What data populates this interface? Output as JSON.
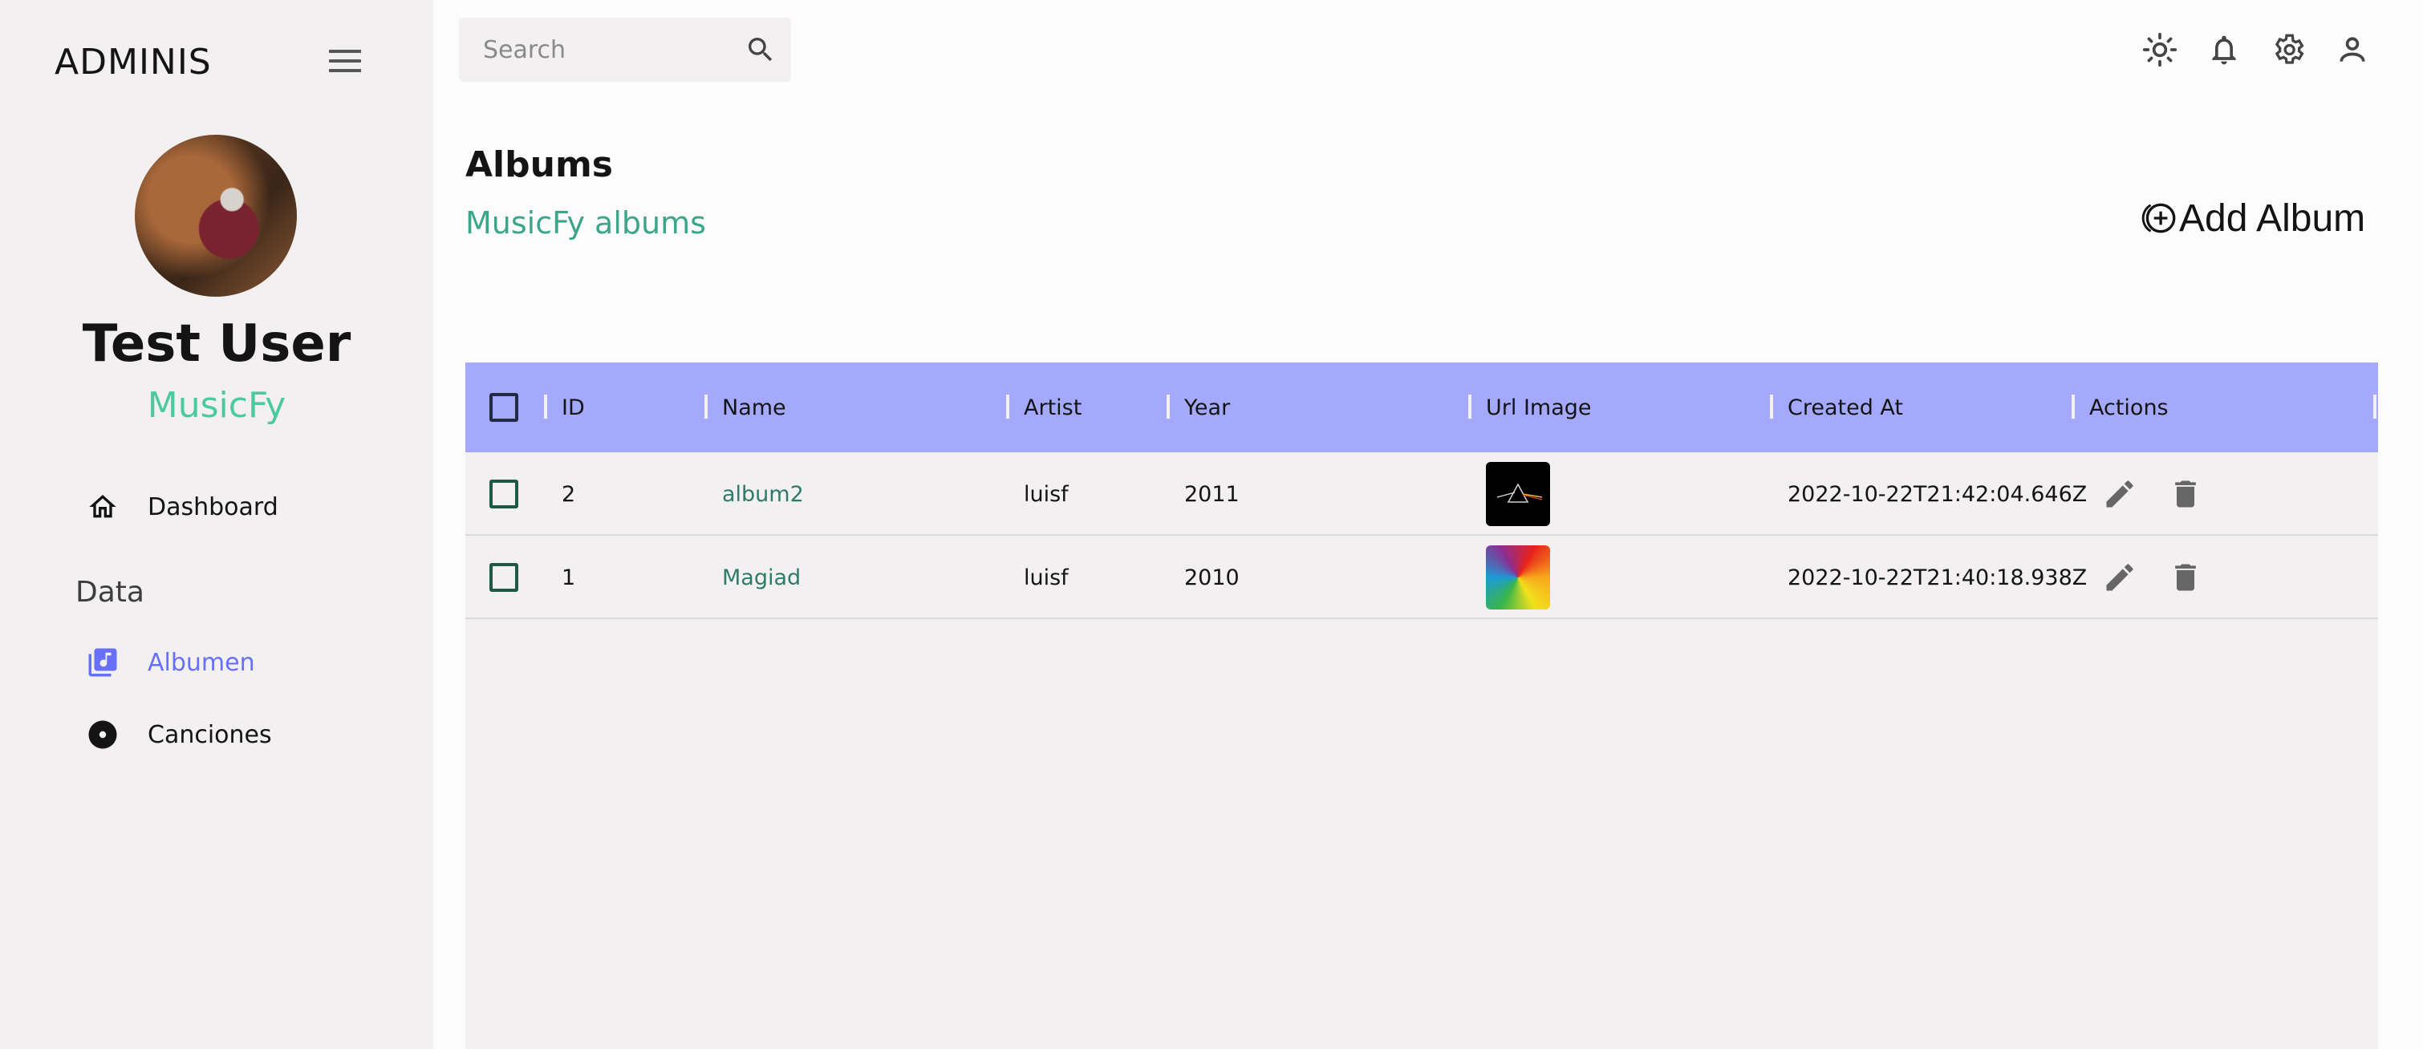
{
  "sidebar": {
    "brand": "ADMINIS",
    "user_name": "Test User",
    "user_role": "MusicFy",
    "section_label": "Data",
    "items": [
      {
        "label": "Dashboard",
        "icon": "home-icon"
      },
      {
        "label": "Albumen",
        "icon": "library-music-icon"
      },
      {
        "label": "Canciones",
        "icon": "disc-icon"
      }
    ]
  },
  "topbar": {
    "search_placeholder": "Search",
    "icons": [
      "light-mode-icon",
      "notifications-icon",
      "settings-icon",
      "person-icon"
    ]
  },
  "header": {
    "title": "Albums",
    "subtitle": "MusicFy albums",
    "add_button": "Add Album"
  },
  "table": {
    "columns": [
      "ID",
      "Name",
      "Artist",
      "Year",
      "Url Image",
      "Created At",
      "Actions"
    ],
    "rows": [
      {
        "id": "2",
        "name": "album2",
        "artist": "luisf",
        "year": "2011",
        "image": "prism-cover",
        "created_at": "2022-10-22T21:42:04.646Z"
      },
      {
        "id": "1",
        "name": "Magiad",
        "artist": "luisf",
        "year": "2010",
        "image": "colorful-cover",
        "created_at": "2022-10-22T21:40:18.938Z"
      }
    ]
  },
  "colors": {
    "accent": "#6870fa",
    "header_bg": "#a4a9fc",
    "subtitle": "#3da58a",
    "role": "#4cc9a0",
    "link": "#2e7c67"
  }
}
